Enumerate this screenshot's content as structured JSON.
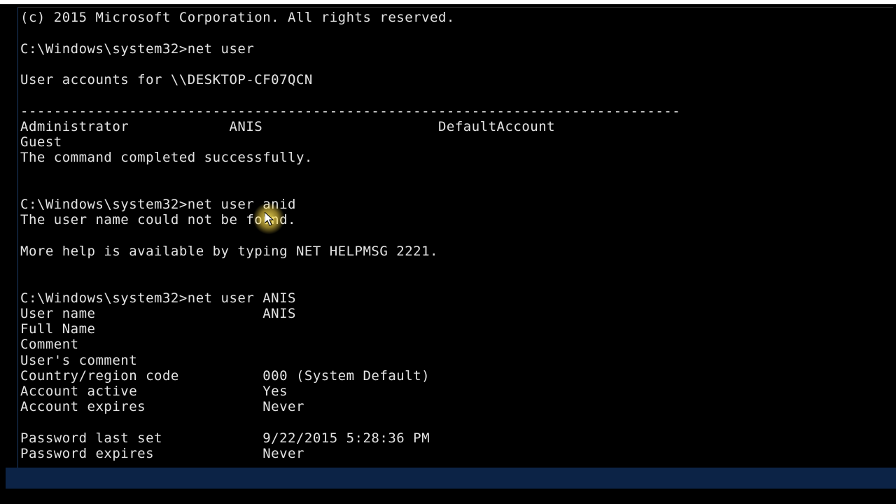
{
  "copyright": "(c) 2015 Microsoft Corporation. All rights reserved.",
  "prompt_path": "C:\\Windows\\system32>",
  "cmd1": "net user",
  "accounts_header": "User accounts for \\\\DESKTOP-CF07QCN",
  "divider": "-------------------------------------------------------------------------------",
  "accounts_row1": "Administrator            ANIS                     DefaultAccount",
  "accounts_row2": "Guest",
  "cmd1_result": "The command completed successfully.",
  "cmd2": "net user anid",
  "cmd2_err1": "The user name could not be found.",
  "cmd2_err2": "More help is available by typing NET HELPMSG 2221.",
  "cmd3": "net user ANIS",
  "details": {
    "r1": "User name                    ANIS",
    "r2": "Full Name",
    "r3": "Comment",
    "r4": "User's comment",
    "r5": "Country/region code          000 (System Default)",
    "r6": "Account active               Yes",
    "r7": "Account expires              Never",
    "r8": "Password last set            9/22/2015 5:28:36 PM",
    "r9": "Password expires             Never"
  }
}
